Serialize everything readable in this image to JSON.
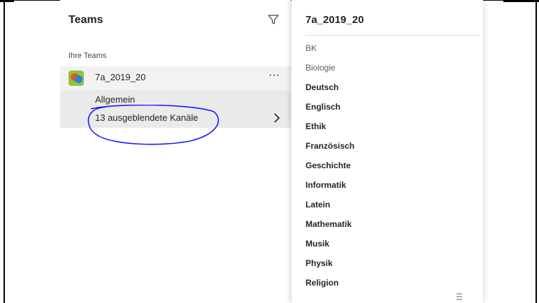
{
  "teams_panel": {
    "header": "Teams",
    "section_label": "Ihre Teams",
    "team": {
      "name": "7a_2019_20",
      "more_label": "···",
      "channels": {
        "general": "Allgemein",
        "hidden": "13 ausgeblendete Kanäle"
      }
    },
    "filter_icon": "filter-icon",
    "chevron_icon": "chevron-right-icon"
  },
  "flyout": {
    "title": "7a_2019_20",
    "channels": [
      {
        "label": "BK",
        "style": "muted"
      },
      {
        "label": "Biologie",
        "style": "muted"
      },
      {
        "label": "Deutsch",
        "style": "bold"
      },
      {
        "label": "Englisch",
        "style": "bold"
      },
      {
        "label": "Ethik",
        "style": "bold"
      },
      {
        "label": "Französisch",
        "style": "bold"
      },
      {
        "label": "Geschichte",
        "style": "bold"
      },
      {
        "label": "Informatik",
        "style": "bold"
      },
      {
        "label": "Latein",
        "style": "bold"
      },
      {
        "label": "Mathematik",
        "style": "bold"
      },
      {
        "label": "Musik",
        "style": "bold"
      },
      {
        "label": "Physik",
        "style": "bold"
      },
      {
        "label": "Religion",
        "style": "bold"
      }
    ]
  },
  "colors": {
    "accent_annotation": "#1a1aff",
    "selected_row": "#f3f2f1",
    "channel_block": "#ebeaea"
  }
}
